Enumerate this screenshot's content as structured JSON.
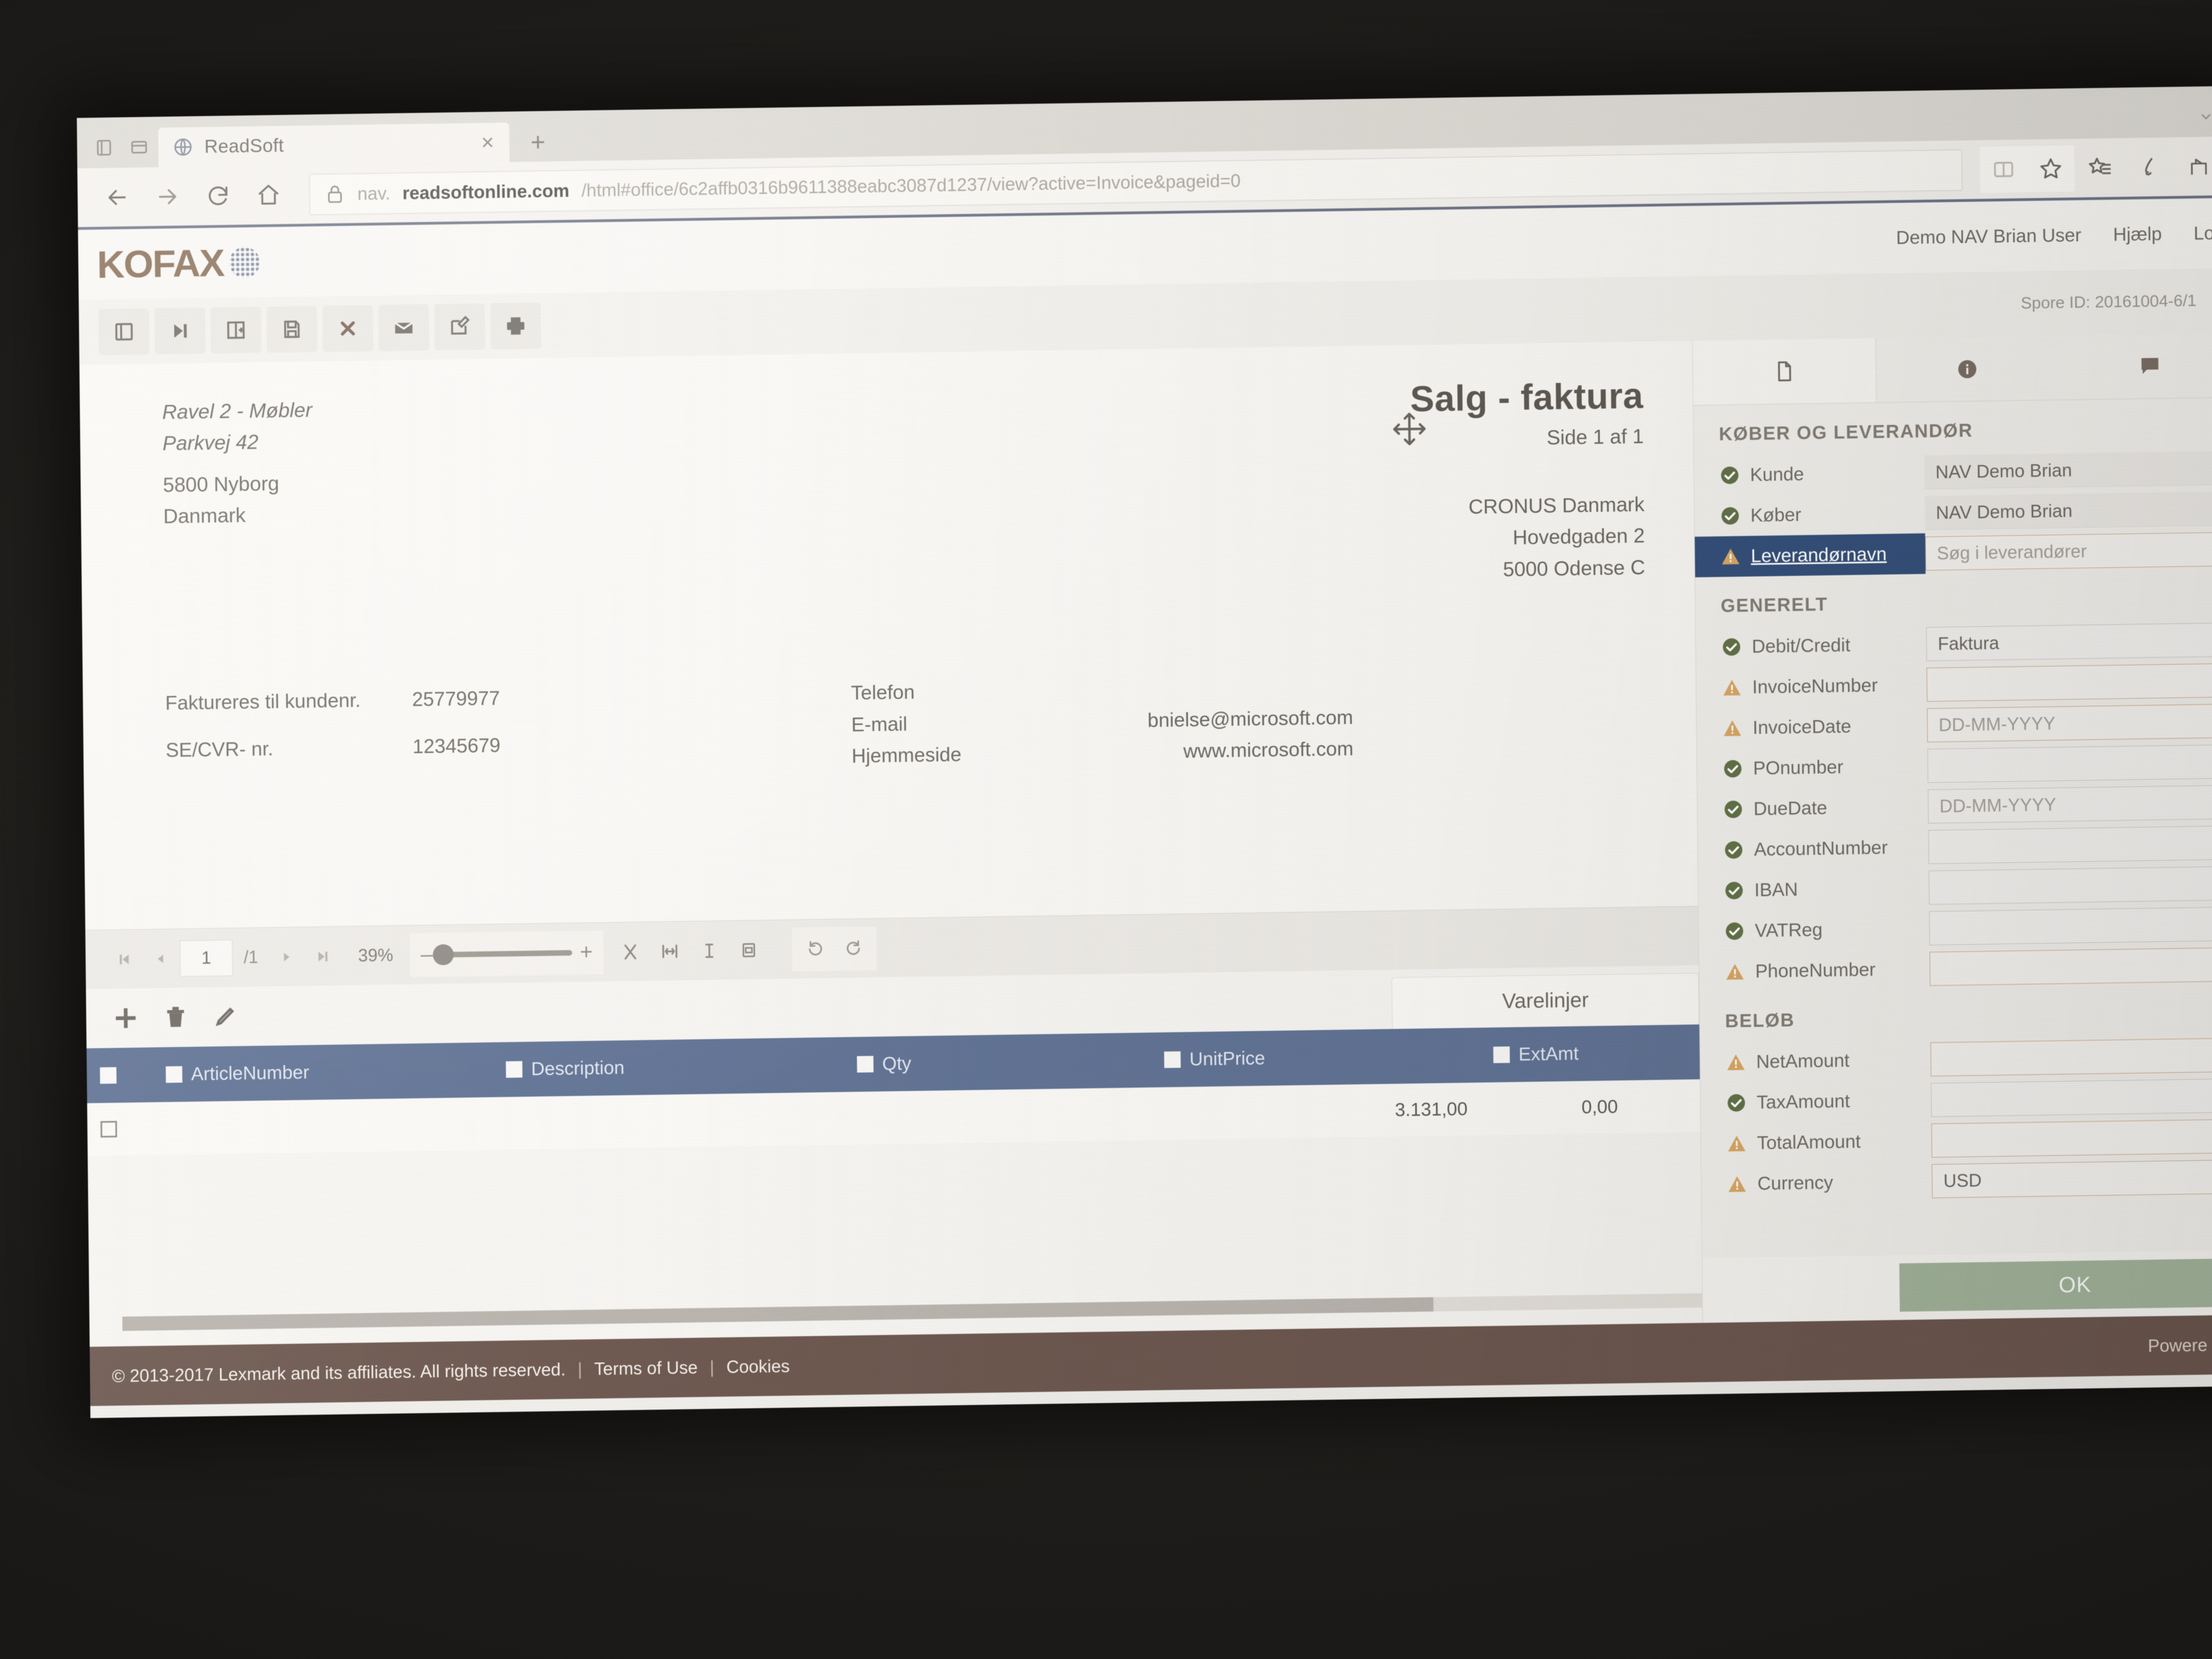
{
  "browser": {
    "tab": {
      "title": "ReadSoft",
      "favicon": "globe-icon",
      "close": "×"
    },
    "newtab_label": "+",
    "url": {
      "scheme": "nav.",
      "host": "readsoftonline.com",
      "path": "/html#office/6c2affb0316b9611388eabc3087d1237/view?active=Invoice&pageid=0",
      "full": "nav.readsoftonline.com/html#office/6c2affb0316b9611388eabc3087d1237/view?active=Invoice&pageid=0"
    },
    "nav": {
      "back": "back-arrow",
      "forward": "forward-arrow",
      "reload": "reload",
      "home": "home"
    }
  },
  "app": {
    "brand": "KOFAX",
    "user": "Demo NAV Brian User",
    "help": "Hjælp",
    "logout": "Lo",
    "spore_id": "Spore ID: 20161004-6/1",
    "toolbar": [
      {
        "name": "view-layout",
        "label": ""
      },
      {
        "name": "next-document",
        "label": ""
      },
      {
        "name": "split-document",
        "label": ""
      },
      {
        "name": "save",
        "label": ""
      },
      {
        "name": "reject",
        "label": ""
      },
      {
        "name": "mail",
        "label": ""
      },
      {
        "name": "edit",
        "label": ""
      },
      {
        "name": "print",
        "label": ""
      }
    ]
  },
  "document": {
    "sender": {
      "name": "Ravel 2 - Møbler",
      "street": "Parkvej 42",
      "city": "5800 Nyborg",
      "country": "Danmark"
    },
    "title": "Salg - faktura",
    "page": "Side 1 af 1",
    "company": {
      "name": "CRONUS Danmark",
      "street": "Hovedgaden 2",
      "city": "5000 Odense C"
    },
    "meta": [
      {
        "label": "Faktureres til kundenr.",
        "value": "25779977"
      },
      {
        "label": "SE/CVR- nr.",
        "value": "12345679"
      }
    ],
    "contact": [
      {
        "label": "Telefon",
        "value": ""
      },
      {
        "label": "E-mail",
        "value": "bnielse@microsoft.com"
      },
      {
        "label": "Hjemmeside",
        "value": "www.microsoft.com"
      }
    ]
  },
  "pdfbar": {
    "page_current": "1",
    "page_total": "/1",
    "zoom": "39%",
    "minus": "–",
    "plus": "+"
  },
  "lines": {
    "tab_label": "Varelinjer",
    "actions": [
      {
        "name": "add-line-button",
        "glyph": "+"
      },
      {
        "name": "delete-line-button",
        "glyph": "trash"
      },
      {
        "name": "edit-line-button",
        "glyph": "pencil"
      }
    ],
    "columns": [
      "ArticleNumber",
      "Description",
      "Qty",
      "UnitPrice",
      "ExtAmt"
    ],
    "rows": [
      {
        "article": "",
        "description": "",
        "qty": "",
        "unitprice": "3.131,00",
        "extamt": "0,00"
      }
    ]
  },
  "panel": {
    "tabs": [
      {
        "name": "document-tab",
        "icon": "document-icon",
        "active": true
      },
      {
        "name": "info-tab",
        "icon": "info-icon",
        "active": false
      },
      {
        "name": "comments-tab",
        "icon": "comment-icon",
        "active": false
      }
    ],
    "sections": [
      {
        "title": "KØBER OG LEVERANDØR",
        "fields": [
          {
            "label": "Kunde",
            "status": "ok",
            "value": "NAV Demo Brian",
            "placeholder": "",
            "style": "flat",
            "selected": false
          },
          {
            "label": "Køber",
            "status": "ok",
            "value": "NAV Demo Brian",
            "placeholder": "",
            "style": "flat",
            "selected": false
          },
          {
            "label": "Leverandørnavn",
            "status": "warn",
            "value": "",
            "placeholder": "Søg i leverandører",
            "style": "warn",
            "selected": true
          }
        ]
      },
      {
        "title": "GENERELT",
        "fields": [
          {
            "label": "Debit/Credit",
            "status": "ok",
            "value": "Faktura",
            "placeholder": "",
            "style": "normal",
            "selected": false
          },
          {
            "label": "InvoiceNumber",
            "status": "warn",
            "value": "",
            "placeholder": "",
            "style": "warn",
            "selected": false
          },
          {
            "label": "InvoiceDate",
            "status": "warn",
            "value": "",
            "placeholder": "DD-MM-YYYY",
            "style": "warn",
            "selected": false
          },
          {
            "label": "POnumber",
            "status": "ok",
            "value": "",
            "placeholder": "",
            "style": "normal",
            "selected": false
          },
          {
            "label": "DueDate",
            "status": "ok",
            "value": "",
            "placeholder": "DD-MM-YYYY",
            "style": "normal",
            "selected": false
          },
          {
            "label": "AccountNumber",
            "status": "ok",
            "value": "",
            "placeholder": "",
            "style": "normal",
            "selected": false
          },
          {
            "label": "IBAN",
            "status": "ok",
            "value": "",
            "placeholder": "",
            "style": "normal",
            "selected": false
          },
          {
            "label": "VATReg",
            "status": "ok",
            "value": "",
            "placeholder": "",
            "style": "normal",
            "selected": false
          },
          {
            "label": "PhoneNumber",
            "status": "warn",
            "value": "",
            "placeholder": "",
            "style": "warn",
            "selected": false
          }
        ]
      },
      {
        "title": "BELØB",
        "fields": [
          {
            "label": "NetAmount",
            "status": "warn",
            "value": "",
            "placeholder": "",
            "style": "warn",
            "selected": false
          },
          {
            "label": "TaxAmount",
            "status": "ok",
            "value": "",
            "placeholder": "",
            "style": "normal",
            "selected": false
          },
          {
            "label": "TotalAmount",
            "status": "warn",
            "value": "",
            "placeholder": "",
            "style": "warn",
            "selected": false
          },
          {
            "label": "Currency",
            "status": "warn",
            "value": "USD",
            "placeholder": "",
            "style": "warn",
            "selected": false
          }
        ]
      }
    ],
    "ok_label": "OK"
  },
  "footer": {
    "copyright": "© 2013-2017 Lexmark and its affiliates. All rights reserved.",
    "terms": "Terms of Use",
    "cookies": "Cookies",
    "powered": "Powere"
  },
  "colors": {
    "brand": "#8a6a4e",
    "grid_header": "#5b7098",
    "selected_field": "#2f4f82",
    "ok_button": "#9cb193",
    "footer": "#6d544a",
    "status_ok": "#5f7240",
    "status_warn": "#e0a355"
  }
}
